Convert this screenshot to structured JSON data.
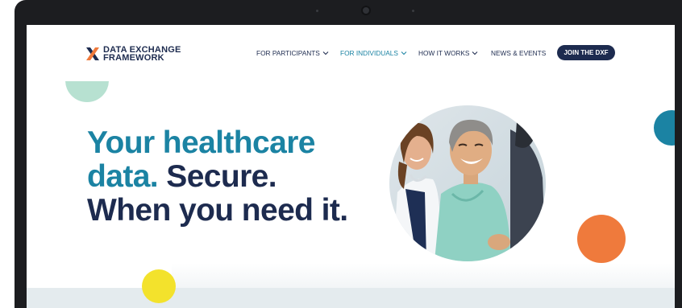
{
  "brand": {
    "line1": "DATA EXCHANGE",
    "line2": "FRAMEWORK",
    "mark_colors": {
      "navy": "#1d2b4f",
      "orange": "#ef7a3c"
    }
  },
  "nav": {
    "items": [
      {
        "label": "FOR PARTICIPANTS",
        "has_dropdown": true,
        "active": false
      },
      {
        "label": "FOR INDIVIDUALS",
        "has_dropdown": true,
        "active": true
      },
      {
        "label": "HOW IT WORKS",
        "has_dropdown": true,
        "active": false
      },
      {
        "label": "NEWS & EVENTS",
        "has_dropdown": false,
        "active": false
      }
    ],
    "cta_label": "JOIN THE DXF"
  },
  "hero": {
    "line1": "Your healthcare",
    "line2_teal": "data.",
    "line2_navy": "Secure.",
    "line3": "When you need it."
  },
  "colors": {
    "navy": "#1d2b4f",
    "teal": "#1b83a3",
    "mint": "#b7e1d1",
    "orange": "#ef7a3c",
    "yellow": "#f3e22c"
  },
  "icons": {
    "nav_dropdown": "chevron-down-icon",
    "logo": "x-logo-icon"
  }
}
